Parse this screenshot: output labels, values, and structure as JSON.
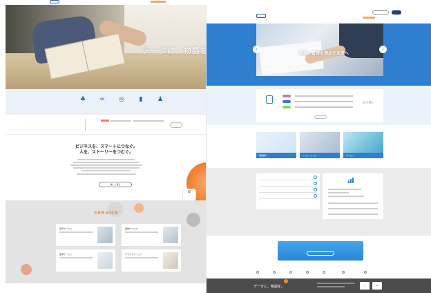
{
  "left_page": {
    "hero_copy": "データに、物語を",
    "service_title": "SERVICE",
    "about_button": "詳しく見る",
    "about_heading_line1": "ビジネスを、スマートにつなぐ。",
    "about_heading_line2": "人を、ストーリーをつむぐ。",
    "services": [
      {
        "title": "保守サービス"
      },
      {
        "title": "開発サービス"
      },
      {
        "title": "運用サービス"
      },
      {
        "title": "クラウドサービス"
      }
    ]
  },
  "right_page": {
    "hero_caption": "経営・管理の理念を未来へ",
    "notice_more": "もっと見る",
    "banners": [
      {
        "label": "事業紹介"
      },
      {
        "label": "ソリューション"
      },
      {
        "label": "サービス"
      }
    ],
    "footer_message": "データに、物語を。"
  },
  "colors": {
    "brand_blue": "#2f7fd0",
    "accent_orange": "#f08a2a",
    "footer_gray": "#4c4c4c"
  }
}
